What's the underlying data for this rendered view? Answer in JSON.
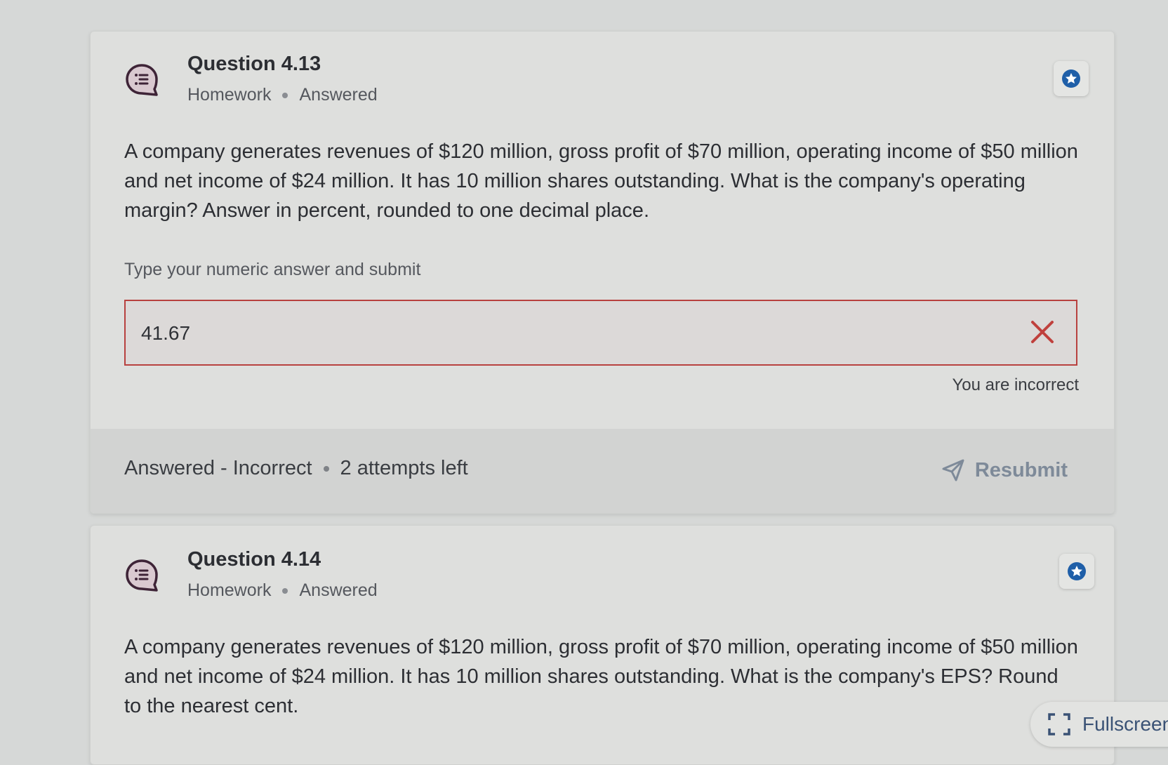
{
  "accent_color": "#1f5fa8",
  "error_color": "#c0403d",
  "questions": [
    {
      "title": "Question 4.13",
      "type": "Homework",
      "state": "Answered",
      "icon": "question-list-icon",
      "favorite_icon": "star-icon",
      "prompt": "A company generates revenues of $120 million, gross profit of $70 million, operating income of $50 million and net income of $24 million. It has 10 million shares outstanding. What is the company's operating margin? Answer in percent, rounded to one decimal place.",
      "answer_label": "Type your numeric answer and submit",
      "answer_value": "41.67",
      "answer_status_icon": "close-icon",
      "feedback": "You are incorrect",
      "footer": {
        "status": "Answered - Incorrect",
        "attempts": "2 attempts left",
        "resubmit_label": "Resubmit",
        "resubmit_icon": "send-icon"
      }
    },
    {
      "title": "Question 4.14",
      "type": "Homework",
      "state": "Answered",
      "icon": "question-list-icon",
      "favorite_icon": "star-icon",
      "prompt": "A company generates revenues of $120 million, gross profit of $70 million, operating income of $50 million and net income of $24 million. It has 10 million shares outstanding. What is the company's EPS? Round to the nearest cent."
    }
  ],
  "fullscreen": {
    "label": "Fullscreen",
    "icon": "fullscreen-icon"
  }
}
